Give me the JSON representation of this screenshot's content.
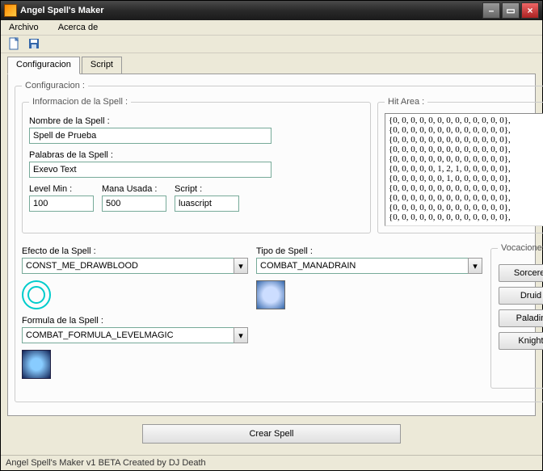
{
  "window": {
    "title": "Angel Spell's Maker"
  },
  "menu": {
    "archivo": "Archivo",
    "acerca": "Acerca de"
  },
  "tabs": {
    "config": "Configuracion",
    "script": "Script"
  },
  "groups": {
    "configuracion": "Configuracion :",
    "info": "Informacion de la Spell :",
    "hitarea": "Hit Area :",
    "vocaciones": "Vocaciones :"
  },
  "labels": {
    "nombre": "Nombre de la Spell :",
    "palabras": "Palabras de la Spell :",
    "levelmin": "Level Min :",
    "mana": "Mana Usada :",
    "script": "Script :",
    "efecto": "Efecto de la Spell :",
    "tipo": "Tipo de Spell :",
    "formula": "Formula de la Spell :"
  },
  "fields": {
    "nombre": "Spell de Prueba",
    "palabras": "Exevo Text",
    "levelmin": "100",
    "mana": "500",
    "script": "luascript",
    "efecto": "CONST_ME_DRAWBLOOD",
    "tipo": "COMBAT_MANADRAIN",
    "formula": "COMBAT_FORMULA_LEVELMAGIC"
  },
  "hitarea_lines": [
    "{0, 0, 0, 0, 0, 0, 0, 0, 0, 0, 0, 0, 0},",
    "{0, 0, 0, 0, 0, 0, 0, 0, 0, 0, 0, 0, 0},",
    "{0, 0, 0, 0, 0, 0, 0, 0, 0, 0, 0, 0, 0},",
    "{0, 0, 0, 0, 0, 0, 0, 0, 0, 0, 0, 0, 0},",
    "{0, 0, 0, 0, 0, 0, 0, 0, 0, 0, 0, 0, 0},",
    "{0, 0, 0, 0, 0, 1, 2, 1, 0, 0, 0, 0, 0},",
    "{0, 0, 0, 0, 0, 0, 1, 0, 0, 0, 0, 0, 0},",
    "{0, 0, 0, 0, 0, 0, 0, 0, 0, 0, 0, 0, 0},",
    "{0, 0, 0, 0, 0, 0, 0, 0, 0, 0, 0, 0, 0},",
    "{0, 0, 0, 0, 0, 0, 0, 0, 0, 0, 0, 0, 0},",
    "{0, 0, 0, 0, 0, 0, 0, 0, 0, 0, 0, 0, 0},"
  ],
  "vocations": {
    "sorcerer": "Sorcerer",
    "druid": "Druid",
    "paladin": "Paladin",
    "knight": "Knight"
  },
  "buttons": {
    "create": "Crear Spell"
  },
  "status": "Angel Spell's Maker v1 BETA Created by DJ Death"
}
